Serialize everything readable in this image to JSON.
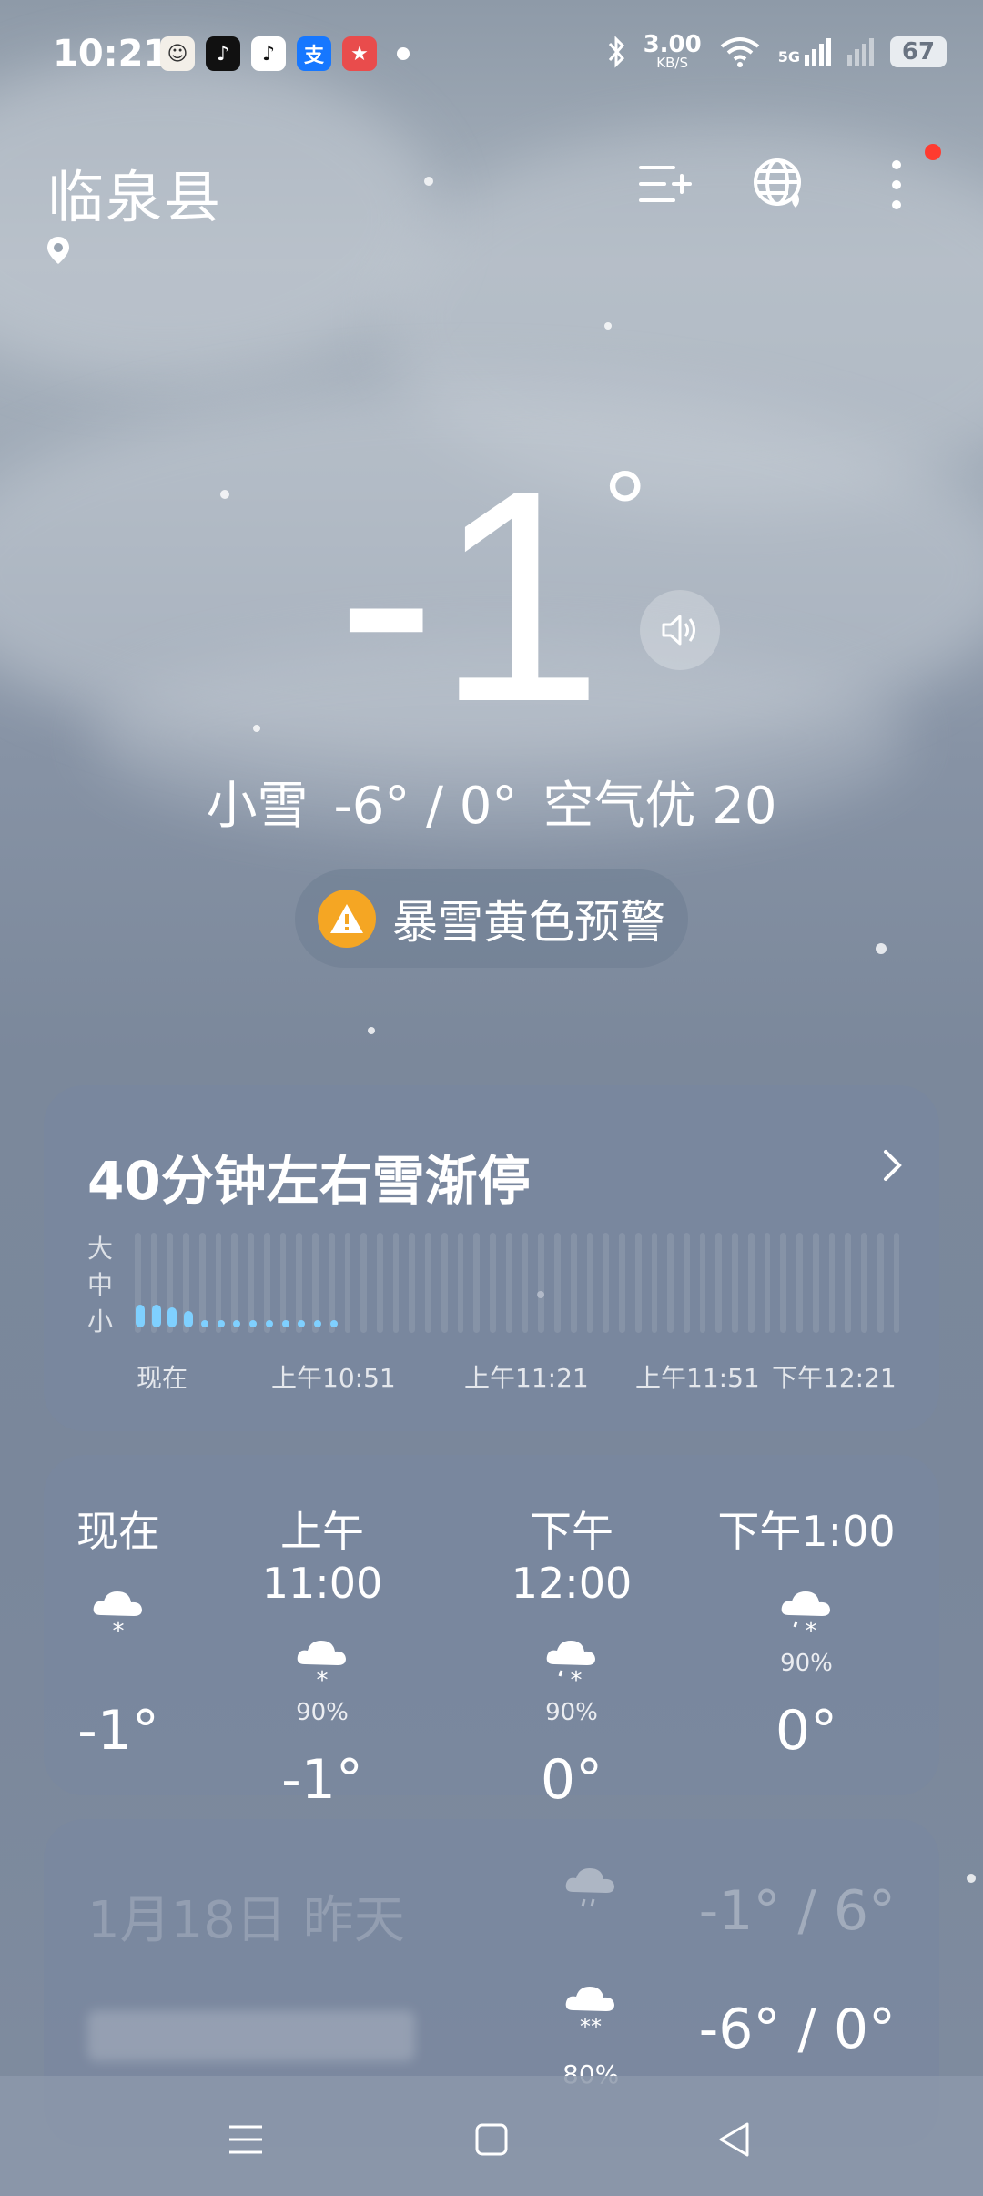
{
  "status_bar": {
    "time": "10:21",
    "network_speed": "3.00",
    "network_unit": "KB/S",
    "battery": "67",
    "signal_label": "5G"
  },
  "header": {
    "city": "临泉县"
  },
  "current": {
    "temperature": "-1",
    "degree_symbol": "°",
    "condition": "小雪",
    "range": "-6° / 0°",
    "air_quality": "空气优 20",
    "warning": "暴雪黄色预警"
  },
  "precip": {
    "title": "40分钟左右雪渐停",
    "intensity_labels": [
      "大",
      "中",
      "小"
    ],
    "time_labels": [
      "现在",
      "上午10:51",
      "上午11:21",
      "上午11:51",
      "下午12:21"
    ],
    "bar_count": 48,
    "levels": [
      0.25,
      0.25,
      0.22,
      0.18,
      0.1,
      0.1,
      0.1,
      0.1,
      0.1,
      0.1,
      0.1,
      0.1,
      0.1,
      0,
      0,
      0,
      0,
      0,
      0,
      0,
      0,
      0,
      0,
      0,
      0,
      0,
      0,
      0,
      0,
      0,
      0,
      0,
      0,
      0,
      0,
      0,
      0,
      0,
      0,
      0,
      0,
      0,
      0,
      0,
      0,
      0,
      0,
      0
    ]
  },
  "hourly": [
    {
      "label": "现在",
      "icon": "light-snow-icon",
      "prob": "",
      "temp": "-1°"
    },
    {
      "label": "上午11:00",
      "icon": "light-snow-icon",
      "prob": "90%",
      "temp": "-1°"
    },
    {
      "label": "下午12:00",
      "icon": "sleet-icon",
      "prob": "90%",
      "temp": "0°"
    },
    {
      "label": "下午1:00",
      "icon": "sleet-icon",
      "prob": "90%",
      "temp": "0°"
    }
  ],
  "daily": [
    {
      "date": "1月18日 昨天",
      "icon": "rain-icon",
      "prob": "",
      "temp": "-1° / 6°",
      "faded": true
    },
    {
      "date": "",
      "icon": "snow-icon",
      "prob": "80%",
      "temp": "-6° / 0°",
      "faded": false
    }
  ],
  "colors": {
    "warning_yellow": "#f5a623",
    "precip_fill": "#7fd0ff",
    "notification_red": "#ff3b30"
  }
}
